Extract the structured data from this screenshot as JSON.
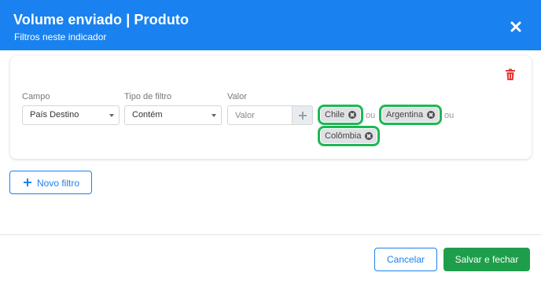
{
  "header": {
    "title": "Volume enviado | Produto",
    "subtitle": "Filtros neste indicador",
    "close_icon": "close-icon",
    "background_color": "#1a82f0"
  },
  "filter": {
    "campo_label": "Campo",
    "campo_value": "País Destino",
    "tipo_label": "Tipo de filtro",
    "tipo_value": "Contém",
    "valor_label": "Valor",
    "valor_placeholder": "Valor",
    "add_icon": "plus-icon",
    "delete_icon": "trash-icon",
    "tags": [
      {
        "label": "Chile"
      },
      {
        "label": "Argentina"
      },
      {
        "label": "Colômbia"
      }
    ],
    "separator": "ou",
    "tag_highlight_color": "#1eb854"
  },
  "novo_filtro_label": "Novo filtro",
  "footer": {
    "cancel_label": "Cancelar",
    "save_label": "Salvar e fechar",
    "save_color": "#1e9e4a"
  }
}
